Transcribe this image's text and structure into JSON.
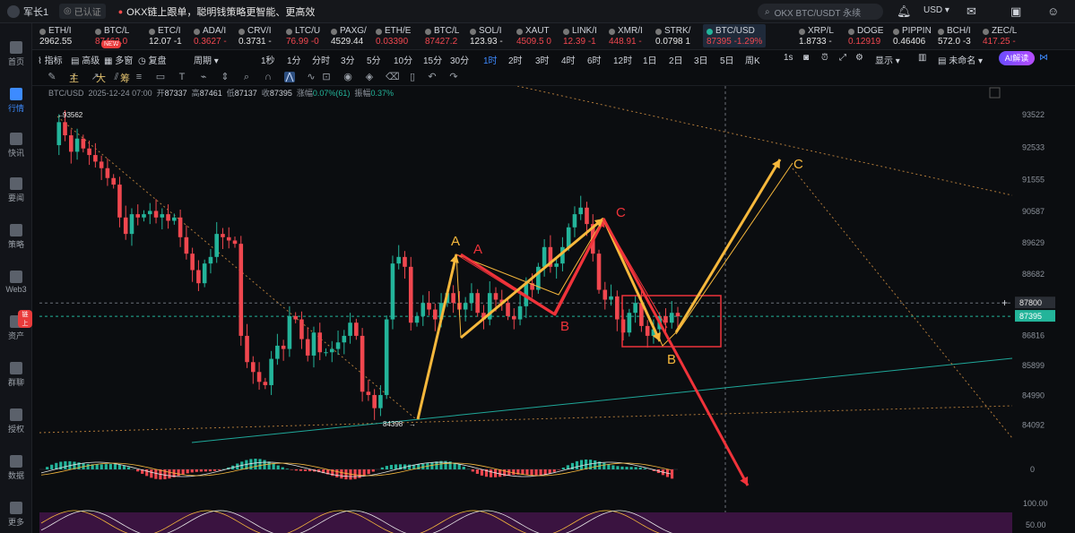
{
  "topbar": {
    "username": "军长1",
    "verified": "已认证",
    "promo": "OKX链上跟单，聪明钱策略更智能、更高效",
    "search_placeholder": "OKX BTC/USDT 永续",
    "currency": "USD",
    "icons": [
      "bell-icon",
      "mail-icon",
      "wallet-icon",
      "profile-icon"
    ]
  },
  "leftnav": [
    {
      "label": "首页",
      "icon": "home-icon"
    },
    {
      "label": "行情",
      "icon": "chart-icon",
      "active": true
    },
    {
      "label": "快讯",
      "icon": "flash-icon"
    },
    {
      "label": "要闻",
      "icon": "news-icon"
    },
    {
      "label": "策略",
      "icon": "strategy-icon"
    },
    {
      "label": "Web3",
      "icon": "web3-icon"
    },
    {
      "label": "资产",
      "icon": "asset-icon",
      "badge": "链上"
    },
    {
      "label": "群聊",
      "icon": "chat-icon"
    },
    {
      "label": "授权",
      "icon": "auth-icon"
    },
    {
      "label": "数据",
      "icon": "data-icon"
    },
    {
      "label": "更多",
      "icon": "more-icon"
    }
  ],
  "tickers": [
    {
      "name": "ETH/I",
      "price": "2962.55",
      "change": ""
    },
    {
      "name": "BTC/L",
      "price": "87462.0",
      "change": ""
    },
    {
      "name": "ETC/I",
      "price": "12.07",
      "change": "-1"
    },
    {
      "name": "ADA/I",
      "price": "0.3627",
      "change": "-"
    },
    {
      "name": "CRV/I",
      "price": "0.3731",
      "change": "-"
    },
    {
      "name": "LTC/U",
      "price": "76.99",
      "change": "-0"
    },
    {
      "name": "PAXG/",
      "price": "4529.44",
      "change": ""
    },
    {
      "name": "ETH/E",
      "price": "0.03390",
      "change": ""
    },
    {
      "name": "BTC/L",
      "price": "87427.2",
      "change": ""
    },
    {
      "name": "SOL/I",
      "price": "123.93",
      "change": "-"
    },
    {
      "name": "XAUT",
      "price": "4509.5",
      "change": "0"
    },
    {
      "name": "LINK/I",
      "price": "12.39",
      "change": "-1"
    },
    {
      "name": "XMR/I",
      "price": "448.91",
      "change": "-"
    },
    {
      "name": "STRK/",
      "price": "0.0798",
      "change": "1"
    },
    {
      "name": "BTC/USD",
      "price": "87395",
      "change": "-1.29%",
      "selected": true
    },
    {
      "name": "XRP/L",
      "price": "1.8733",
      "change": "-"
    },
    {
      "name": "DOGE",
      "price": "0.12919",
      "change": ""
    },
    {
      "name": "PIPPIN",
      "price": "0.46406",
      "change": ""
    },
    {
      "name": "BCH/I",
      "price": "572.0",
      "change": "-3"
    },
    {
      "name": "ZEC/L",
      "price": "417.25",
      "change": "-"
    }
  ],
  "new_badge": "NEW",
  "toolbar": {
    "indicators": "指标",
    "advanced": "高级",
    "multi": "多窗",
    "replay": "复盘",
    "period": "周期",
    "intervals": [
      "1秒",
      "1分",
      "分时",
      "3分",
      "5分",
      "10分",
      "15分",
      "30分",
      "1时",
      "2时",
      "3时",
      "4时",
      "6时",
      "12时",
      "1日",
      "2日",
      "3日",
      "5日",
      "周K"
    ],
    "active_interval": "1时",
    "realtime": "1s",
    "display": "显示",
    "unnamed": "未命名",
    "ai_button": "AI解读"
  },
  "indicator_tabs": [
    "主",
    "大",
    "筹"
  ],
  "ohlc": {
    "symbol": "BTC/USD",
    "time": "2025-12-24 07:00",
    "open_label": "开",
    "open": "87337",
    "high_label": "高",
    "high": "87461",
    "low_label": "低",
    "low": "87137",
    "close_label": "收",
    "close": "87395",
    "change_label": "涨幅",
    "change": "0.07%(61)",
    "amp_label": "振幅",
    "amp": "0.37%"
  },
  "chart_data": {
    "type": "line",
    "y_axis_ticks": [
      93522,
      92533,
      91555,
      90587,
      89629,
      88682,
      87800,
      86816,
      85899,
      84990,
      84092
    ],
    "y_range": [
      83500,
      94400
    ],
    "current_price": "87395",
    "crosshair_price": "87800",
    "high_marker": "93562",
    "low_marker": "84398",
    "price_series": [
      92600,
      93300,
      92900,
      92400,
      92800,
      92500,
      92300,
      92100,
      91900,
      91600,
      91400,
      90400,
      89900,
      90500,
      90400,
      90500,
      90600,
      90400,
      90500,
      90300,
      90400,
      89800,
      89300,
      88800,
      88400,
      89000,
      89200,
      89900,
      89800,
      89700,
      89600,
      86800,
      86000,
      85700,
      85400,
      85300,
      86100,
      86500,
      86400,
      87400,
      87300,
      86700,
      86200,
      86900,
      86300,
      86300,
      86400,
      86600,
      86800,
      87200,
      86800,
      85100,
      85000,
      84600,
      85000,
      87300,
      89000,
      89200,
      88900,
      87200,
      87400,
      87800,
      87600,
      87300,
      87800,
      88100,
      87800,
      87600,
      87800,
      88100,
      87500,
      87300,
      88100,
      87900,
      87800,
      87400,
      87300,
      87700,
      88400,
      88200,
      88900,
      89500,
      88900,
      89000,
      89500,
      90100,
      90500,
      90700,
      90200,
      89300,
      88200,
      87900,
      88000,
      87300,
      86900,
      87500,
      87800,
      87100,
      86800,
      87000,
      87400,
      87200,
      87500,
      87395
    ],
    "annotations": [
      {
        "label": "A",
        "color": "orange"
      },
      {
        "label": "A",
        "color": "red"
      },
      {
        "label": "B",
        "color": "red"
      },
      {
        "label": "C",
        "color": "red"
      },
      {
        "label": "B",
        "color": "orange"
      },
      {
        "label": "C",
        "color": "orange"
      }
    ],
    "macd_zero_label": "0",
    "osc_labels": [
      "100.00",
      "50.00"
    ]
  },
  "colors": {
    "up": "#23b49a",
    "down": "#f0474f",
    "accent": "#3d8bff",
    "annot_orange": "#f6b83c",
    "annot_red": "#f0333a"
  }
}
